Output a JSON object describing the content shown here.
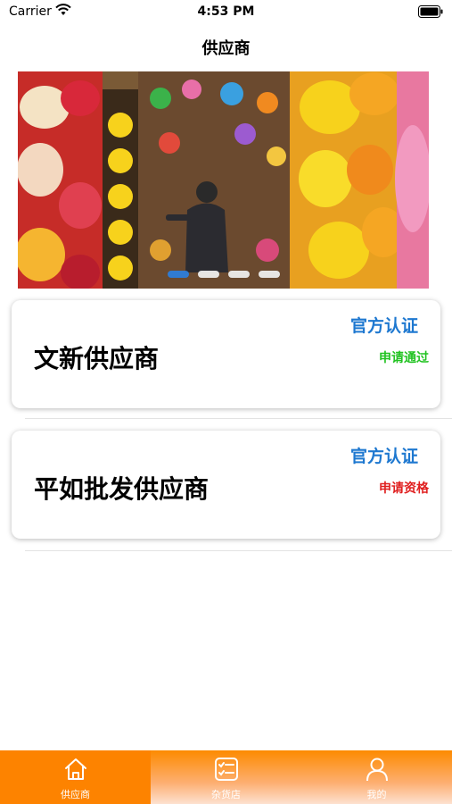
{
  "status_bar": {
    "carrier": "Carrier",
    "time": "4:53 PM"
  },
  "nav": {
    "title": "供应商"
  },
  "banner": {
    "pages": 4,
    "current_page": 1
  },
  "suppliers": [
    {
      "name": "文新供应商",
      "certification": "官方认证",
      "status": "申请通过",
      "status_color": "#22c322"
    },
    {
      "name": "平如批发供应商",
      "certification": "官方认证",
      "status": "申请资格",
      "status_color": "#e02020"
    }
  ],
  "tabs": [
    {
      "label": "供应商",
      "icon": "home-icon",
      "active": true
    },
    {
      "label": "杂货店",
      "icon": "checklist-icon",
      "active": false
    },
    {
      "label": "我的",
      "icon": "person-icon",
      "active": false
    }
  ],
  "colors": {
    "accent": "#fd8300",
    "link_blue": "#1e78d0",
    "dot_active": "#2b7fe0"
  }
}
